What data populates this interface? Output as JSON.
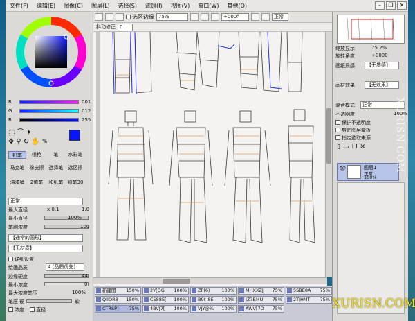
{
  "menu": {
    "items": [
      "文件(F)",
      "编辑(E)",
      "图像(C)",
      "图层(L)",
      "选择(S)",
      "滤镜(I)",
      "视图(V)",
      "窗口(W)",
      "其他(O)"
    ]
  },
  "toolbar": {
    "selection_edge_label": "选区边缘",
    "zoom_value": "75%",
    "rotation_value": "+000°",
    "blend_mode": "正常",
    "stabilizer_label": "抖动修正",
    "stabilizer_value": "0"
  },
  "color": {
    "r_label": "R",
    "r_value": "001",
    "g_label": "G",
    "g_value": "012",
    "b_label": "B",
    "b_value": "255",
    "primary": "#0a14ff"
  },
  "tools": {
    "row1": [
      "铅笔",
      "喷枪",
      "笔",
      "水彩笔"
    ],
    "row2": [
      "马克笔",
      "橡皮擦",
      "选择笔",
      "选区擦"
    ],
    "row3": [
      "油漆桶",
      "2值笔",
      "和纸笔",
      "铅笔30"
    ]
  },
  "brush": {
    "mode": "正常",
    "max_diameter_label": "最大直径",
    "size_multiplier": "x 0.1",
    "size_value": "1.0",
    "min_diameter_label": "最小直径",
    "min_diameter_value": "100%",
    "density_label": "笔刷浓度",
    "density_value": "100",
    "shape_label": "【通常的圆形】",
    "texture_label": "【无材质】",
    "advanced_label": "详细设置",
    "quality_label": "绘画品质",
    "quality_value": "4 (品质优先)",
    "edge_hardness_label": "边缘硬度",
    "edge_hardness_value": "44",
    "min_density_label": "最小浓度",
    "min_density_value": "0",
    "max_pressure_label": "最大浓度笔压",
    "max_pressure_value": "100%",
    "pressure_label": "笔压",
    "pressure_hard": "硬",
    "pressure_soft": "软",
    "density_cb": "浓度",
    "diameter_cb": "直径"
  },
  "navigator": {
    "zoom_label": "缩放显示",
    "zoom_value": "75.2%",
    "angle_label": "旋转角度",
    "angle_value": "+0000"
  },
  "layer_panel": {
    "paper_label": "画纸质感",
    "paper_value": "【无质感】",
    "effect_label": "画材效果",
    "effect_value": "【无效果】",
    "blend_label": "混合模式",
    "blend_value": "正常",
    "opacity_label": "不透明度",
    "opacity_value": "100%",
    "protect_label": "保护不透明度",
    "clip_label": "剪贴图层蒙板",
    "source_label": "指定选取来源",
    "layer_name": "图层1",
    "layer_mode": "正常",
    "layer_opacity": "100%"
  },
  "files": [
    {
      "name": "新建图",
      "pct": "150%"
    },
    {
      "name": "2Y[OGl",
      "pct": "100%"
    },
    {
      "name": "ZP(6)",
      "pct": "100%"
    },
    {
      "name": "MHXXZJ",
      "pct": "75%"
    },
    {
      "name": "5SBE8A",
      "pct": "75%"
    },
    {
      "name": "QIIOR3",
      "pct": "150%"
    },
    {
      "name": "C588E[",
      "pct": "100%"
    },
    {
      "name": "B9(_8E",
      "pct": "100%"
    },
    {
      "name": "JZ7BMU",
      "pct": "75%"
    },
    {
      "name": "2TJHMT",
      "pct": "75%"
    },
    {
      "name": "CTRSP]",
      "pct": "75%"
    },
    {
      "name": "4BVJ7[",
      "pct": "100%"
    },
    {
      "name": "VJY@%",
      "pct": "100%"
    },
    {
      "name": "AWV[7D",
      "pct": "75%"
    }
  ],
  "watermark": {
    "vertical": "XURISN.COM",
    "logo": "XURISN.COM"
  },
  "colors": {
    "panel_bg": "#dcdad6",
    "canvas_bg": "#f4f3f1",
    "pencil_blue": "#1e2ee0",
    "sketch_gray": "#3a3a3a",
    "accent_orange": "#e0a060"
  }
}
